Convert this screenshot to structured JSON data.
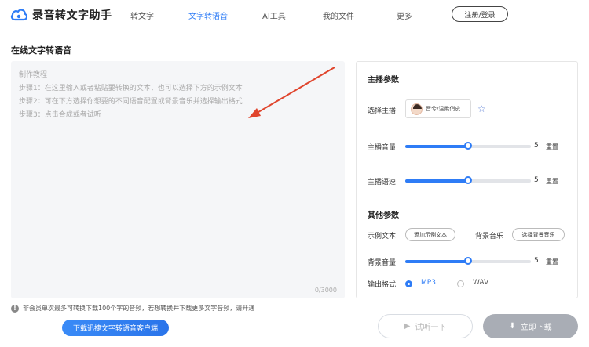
{
  "header": {
    "logo_text": "录音转文字助手",
    "nav": [
      "转文字",
      "文字转语音",
      "AI工具",
      "我的文件",
      "更多"
    ],
    "login_label": "注册/登录"
  },
  "main": {
    "title": "在线文字转语音",
    "editor": {
      "placeholder_lines": [
        "制作教程",
        "步骤1：在这里输入或者粘贴要转换的文本，也可以选择下方的示例文本",
        "步骤2：可在下方选择你想要的不同语音配置或背景音乐并选择输出格式",
        "步骤3：点击合成或者试听"
      ],
      "counter": "0/3000"
    },
    "notice": "非会员单次最多可转换下载100个字的音频，若想转换并下载更多文字音频，请开通",
    "download_client_label": "下载迅捷文字转语音客户端"
  },
  "panel": {
    "anchor_section": "主播参数",
    "select_anchor_label": "选择主播",
    "anchor_name": "晋兮/温柔俏皮",
    "volume_label": "主播音量",
    "volume_value": "5",
    "volume_fraction": 0.5,
    "speed_label": "主播语速",
    "speed_value": "5",
    "speed_fraction": 0.5,
    "reset_label": "重置",
    "other_section": "其他参数",
    "sample_text_label": "示例文本",
    "add_sample_label": "添加示例文本",
    "bg_music_label": "背景音乐",
    "select_bg_music_label": "选择背景音乐",
    "bg_volume_label": "背景音量",
    "bg_volume_value": "5",
    "bg_volume_fraction": 0.5,
    "output_format_label": "输出格式",
    "formats": [
      "MP3",
      "WAV"
    ],
    "selected_format": "MP3"
  },
  "actions": {
    "try_label": "试听一下",
    "download_label": "立即下载"
  },
  "colors": {
    "accent": "#2e7cf6",
    "arrow": "#e0452d"
  }
}
